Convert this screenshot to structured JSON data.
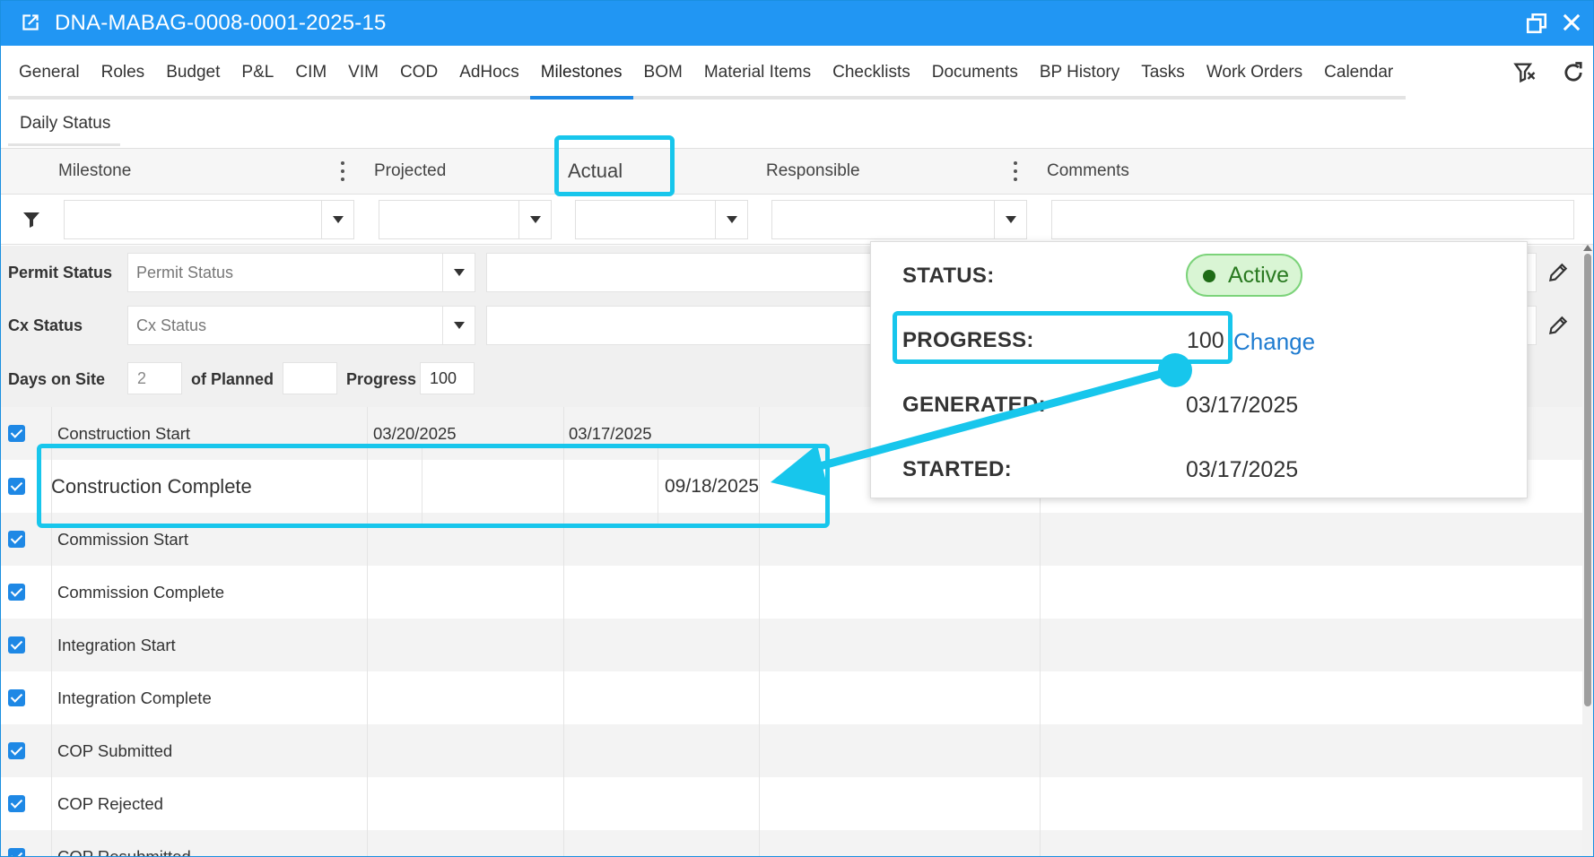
{
  "window": {
    "title": "DNA-MABAG-0008-0001-2025-15"
  },
  "tabs": [
    {
      "label": "General"
    },
    {
      "label": "Roles"
    },
    {
      "label": "Budget"
    },
    {
      "label": "P&L"
    },
    {
      "label": "CIM"
    },
    {
      "label": "VIM"
    },
    {
      "label": "COD"
    },
    {
      "label": "AdHocs"
    },
    {
      "label": "Milestones"
    },
    {
      "label": "BOM"
    },
    {
      "label": "Material Items"
    },
    {
      "label": "Checklists"
    },
    {
      "label": "Documents"
    },
    {
      "label": "BP History"
    },
    {
      "label": "Tasks"
    },
    {
      "label": "Work Orders"
    },
    {
      "label": "Calendar"
    }
  ],
  "active_tab": "Milestones",
  "subtab": "Daily Status",
  "columns": {
    "milestone": "Milestone",
    "projected": "Projected",
    "actual": "Actual",
    "responsible": "Responsible",
    "comments": "Comments"
  },
  "status_fields": {
    "permit_label": "Permit Status",
    "permit_placeholder": "Permit Status",
    "cx_label": "Cx Status",
    "cx_placeholder": "Cx Status",
    "days_label": "Days on Site",
    "days_value": "2",
    "planned_label": "of Planned",
    "planned_value": "",
    "progress_label": "Progress",
    "progress_value": "100"
  },
  "rows": [
    {
      "milestone": "Construction Start",
      "projected": "03/20/2025",
      "actual": "03/17/2025",
      "checked": true
    },
    {
      "milestone": "Construction Complete",
      "projected": "",
      "actual": "09/18/2025",
      "checked": true
    },
    {
      "milestone": "Commission Start",
      "projected": "",
      "actual": "",
      "checked": true
    },
    {
      "milestone": "Commission Complete",
      "projected": "",
      "actual": "",
      "checked": true
    },
    {
      "milestone": "Integration Start",
      "projected": "",
      "actual": "",
      "checked": true
    },
    {
      "milestone": "Integration Complete",
      "projected": "",
      "actual": "",
      "checked": true
    },
    {
      "milestone": "COP Submitted",
      "projected": "",
      "actual": "",
      "checked": true
    },
    {
      "milestone": "COP Rejected",
      "projected": "",
      "actual": "",
      "checked": true
    },
    {
      "milestone": "COP Resubmitted",
      "projected": "",
      "actual": "",
      "checked": true
    }
  ],
  "popup": {
    "status_label": "STATUS:",
    "status_value": "Active",
    "progress_label": "PROGRESS:",
    "progress_value": "100",
    "change_link": "Change",
    "generated_label": "GENERATED:",
    "generated_value": "03/17/2025",
    "started_label": "STARTED:",
    "started_value": "03/17/2025"
  },
  "colors": {
    "titlebar": "#2196f3",
    "accent": "#1e88e5",
    "highlight": "#17c6ec",
    "active_badge": "#d9f5d4"
  },
  "icons": [
    "external-link-icon",
    "restore-window-icon",
    "close-icon",
    "clear-filter-icon",
    "refresh-icon",
    "filter-icon",
    "column-menu-icon",
    "dropdown-arrow-icon",
    "pencil-icon",
    "checkbox-icon"
  ]
}
